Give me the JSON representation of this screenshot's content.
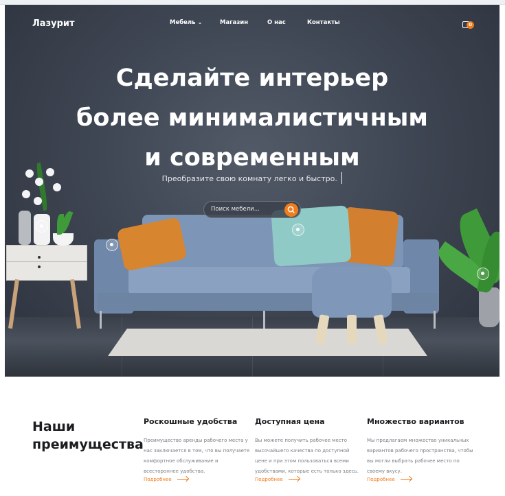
{
  "brand": {
    "name": "Лазурит"
  },
  "nav": {
    "items": [
      {
        "label": "Мебель ⌄"
      },
      {
        "label": "Магазин"
      },
      {
        "label": "О нас"
      },
      {
        "label": "Контакты"
      }
    ],
    "cart_count": "0",
    "cart_icon": "shopping-bag-icon"
  },
  "hero": {
    "headline_lines": [
      "Сделайте интерьер",
      "более минималистичным",
      "и современным"
    ],
    "subtitle": "Преобразите свою комнату легко и быстро.",
    "search_placeholder": "Поиск мебели...",
    "search_icon": "search-icon"
  },
  "advantages": {
    "title_line1": "Наши",
    "title_line2": "преимущества",
    "items": [
      {
        "title": "Роскошные удобства",
        "text": "Преимущество аренды рабочего места у нас заключается в том, что вы получаете комфортное обслуживание и всестороннее удобства.",
        "more": "Подробнее"
      },
      {
        "title": "Доступная цена",
        "text": "Вы можете получить рабочее место высочайшего качества по доступной цене и при этом пользоваться всеми удобствами, которые есть только здесь.",
        "more": "Подробнее"
      },
      {
        "title": "Множество вариантов",
        "text": "Мы предлагаем множество уникальных вариантов рабочего пространства, чтобы вы могли выбрать рабочее место по своему вкусу.",
        "more": "Подробнее"
      }
    ]
  },
  "colors": {
    "accent": "#f07c1c",
    "hero_bg": "#3f4653",
    "sofa": "#7d95b6"
  }
}
